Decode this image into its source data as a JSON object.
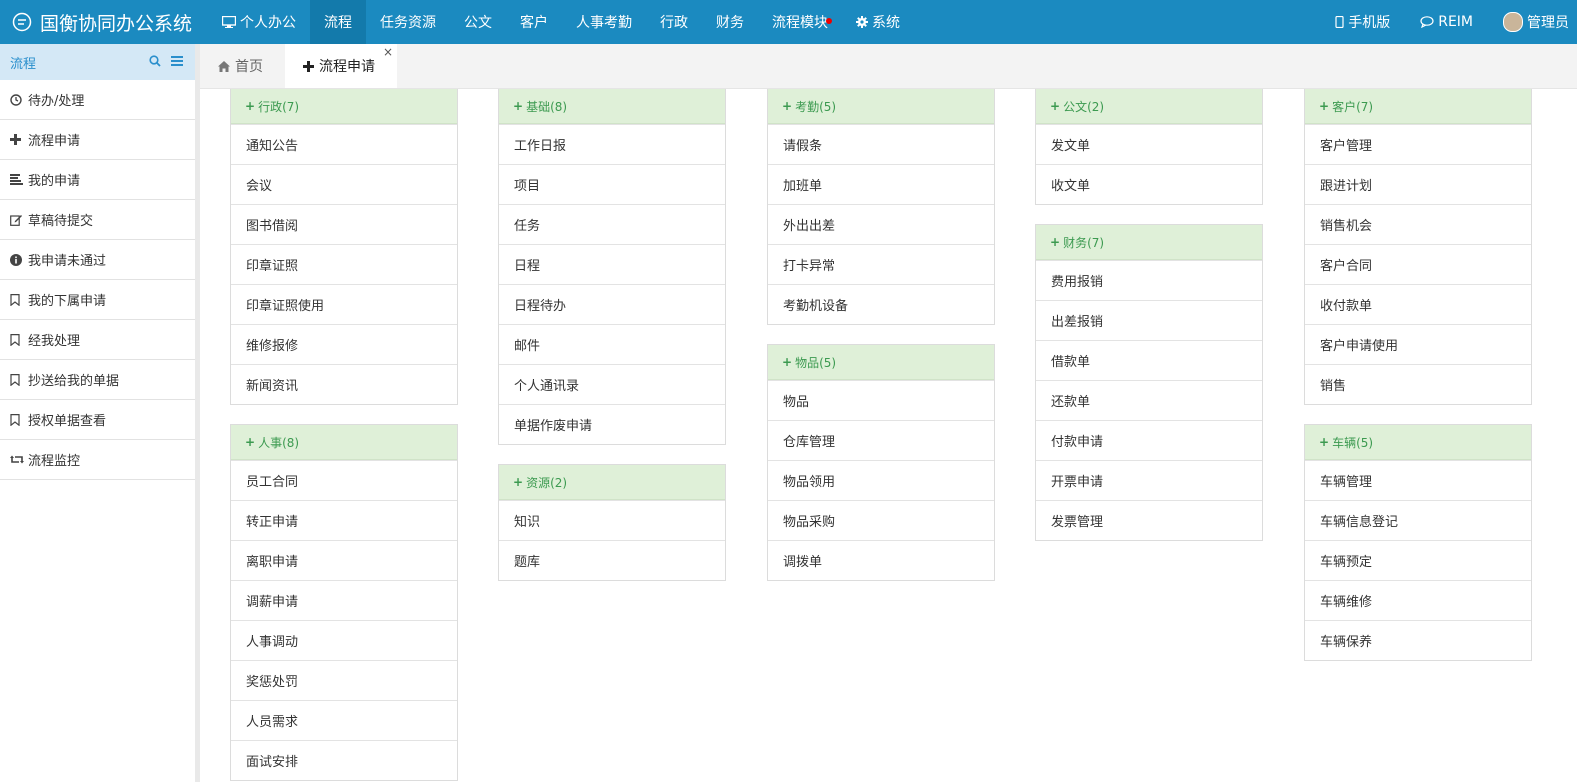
{
  "app": {
    "title": "国衡协同办公系统"
  },
  "nav": [
    {
      "label": "个人办公",
      "icon": "monitor-icon"
    },
    {
      "label": "流程"
    },
    {
      "label": "任务资源"
    },
    {
      "label": "公文"
    },
    {
      "label": "客户"
    },
    {
      "label": "人事考勤"
    },
    {
      "label": "行政"
    },
    {
      "label": "财务"
    },
    {
      "label": "流程模块",
      "dot": true
    },
    {
      "label": "系统",
      "icon": "gear-icon"
    }
  ],
  "topright": {
    "mobile": "手机版",
    "reim": "REIM",
    "user": "管理员"
  },
  "sidebar": {
    "title": "流程",
    "items": [
      {
        "label": "待办/处理",
        "icon": "clock-icon"
      },
      {
        "label": "流程申请",
        "icon": "plus-icon"
      },
      {
        "label": "我的申请",
        "icon": "list-icon"
      },
      {
        "label": "草稿待提交",
        "icon": "edit-icon"
      },
      {
        "label": "我申请未通过",
        "icon": "info-icon"
      },
      {
        "label": "我的下属申请",
        "icon": "bookmark-icon"
      },
      {
        "label": "经我处理",
        "icon": "bookmark-icon"
      },
      {
        "label": "抄送给我的单据",
        "icon": "bookmark-icon"
      },
      {
        "label": "授权单据查看",
        "icon": "bookmark-icon"
      },
      {
        "label": "流程监控",
        "icon": "retweet-icon"
      }
    ]
  },
  "tabs": {
    "home": "首页",
    "active": "流程申请",
    "close": "×"
  },
  "columns": [
    [
      {
        "title": "行政(7)",
        "items": [
          "通知公告",
          "会议",
          "图书借阅",
          "印章证照",
          "印章证照使用",
          "维修报修",
          "新闻资讯"
        ]
      },
      {
        "title": "人事(8)",
        "items": [
          "员工合同",
          "转正申请",
          "离职申请",
          "调薪申请",
          "人事调动",
          "奖惩处罚",
          "人员需求",
          "面试安排"
        ]
      }
    ],
    [
      {
        "title": "基础(8)",
        "items": [
          "工作日报",
          "项目",
          "任务",
          "日程",
          "日程待办",
          "邮件",
          "个人通讯录",
          "单据作废申请"
        ]
      },
      {
        "title": "资源(2)",
        "items": [
          "知识",
          "题库"
        ]
      }
    ],
    [
      {
        "title": "考勤(5)",
        "items": [
          "请假条",
          "加班单",
          "外出出差",
          "打卡异常",
          "考勤机设备"
        ]
      },
      {
        "title": "物品(5)",
        "items": [
          "物品",
          "仓库管理",
          "物品领用",
          "物品采购",
          "调拨单"
        ]
      }
    ],
    [
      {
        "title": "公文(2)",
        "items": [
          "发文单",
          "收文单"
        ]
      },
      {
        "title": "财务(7)",
        "items": [
          "费用报销",
          "出差报销",
          "借款单",
          "还款单",
          "付款申请",
          "开票申请",
          "发票管理"
        ]
      }
    ],
    [
      {
        "title": "客户(7)",
        "items": [
          "客户管理",
          "跟进计划",
          "销售机会",
          "客户合同",
          "收付款单",
          "客户申请使用",
          "销售"
        ]
      },
      {
        "title": "车辆(5)",
        "items": [
          "车辆管理",
          "车辆信息登记",
          "车辆预定",
          "车辆维修",
          "车辆保养"
        ]
      }
    ]
  ],
  "colors": {
    "topbar": "#1b8ac0",
    "nav_active": "#137aab",
    "panel_head": "#dff0d8",
    "panel_head_text": "#3c9a50",
    "sidebar_head": "#d4e8f6"
  }
}
